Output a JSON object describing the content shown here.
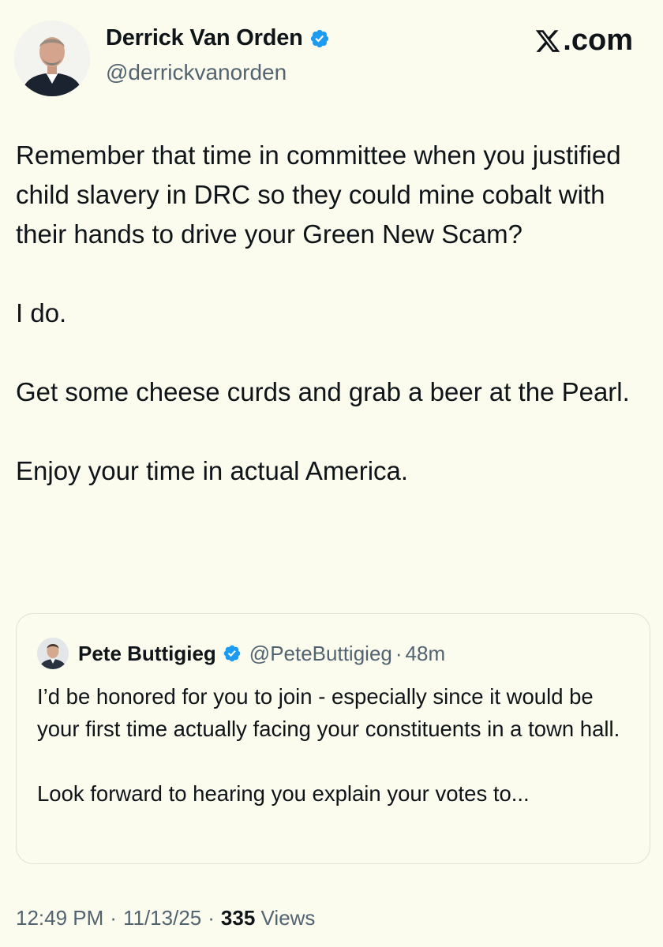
{
  "author": {
    "name": "Derrick Van Orden",
    "handle": "@derrickvanorden",
    "verified": true
  },
  "site_logo": {
    "text": ".com",
    "icon": "x-logo-icon"
  },
  "tweet": {
    "paragraphs": [
      "Remember that time in committee when you justified child slavery in DRC so they could mine cobalt with their hands to drive your Green New Scam?",
      "I do.",
      "Get some cheese curds and grab a beer at the Pearl.",
      "Enjoy your time in actual America."
    ]
  },
  "quoted_tweet": {
    "name": "Pete Buttigieg",
    "handle": "@PeteButtigieg",
    "separator": "·",
    "time": "48m",
    "paragraphs": [
      "I’d be honored for you to join - especially since it would be your first time actually facing your constituents in a town hall.",
      "Look forward to hearing you explain your votes to..."
    ]
  },
  "meta": {
    "time": "12:49 PM",
    "date": "11/13/25",
    "separator": "·",
    "views_count": "335",
    "views_label": "Views"
  },
  "colors": {
    "background": "#fbfbee",
    "verified_blue": "#1d9bf0",
    "text_primary": "#0f1419",
    "text_secondary": "#536471"
  }
}
